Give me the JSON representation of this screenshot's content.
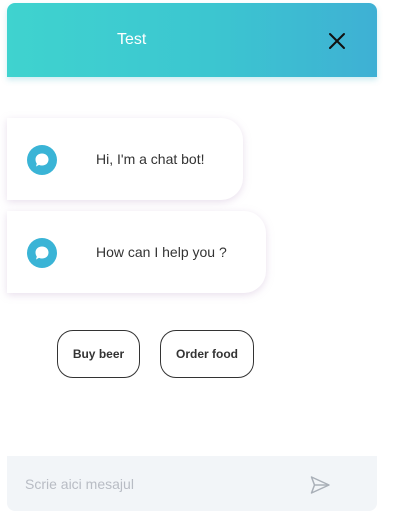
{
  "header": {
    "title": "Test",
    "close_icon": "close-icon"
  },
  "messages": [
    {
      "sender": "bot",
      "icon": "chat-bubble-icon",
      "text": "Hi, I'm a chat bot!"
    },
    {
      "sender": "bot",
      "icon": "chat-bubble-icon",
      "text": "How can I help you ?"
    }
  ],
  "quick_replies": [
    {
      "label": "Buy beer"
    },
    {
      "label": "Order food"
    }
  ],
  "composer": {
    "placeholder": "Scrie aici mesajul",
    "value": "",
    "send_icon": "send-icon"
  },
  "colors": {
    "header_gradient_start": "#3fd3cf",
    "header_gradient_end": "#3eb0d4",
    "bot_icon": "#3ab4d6",
    "composer_bg": "#f2f5f8"
  }
}
